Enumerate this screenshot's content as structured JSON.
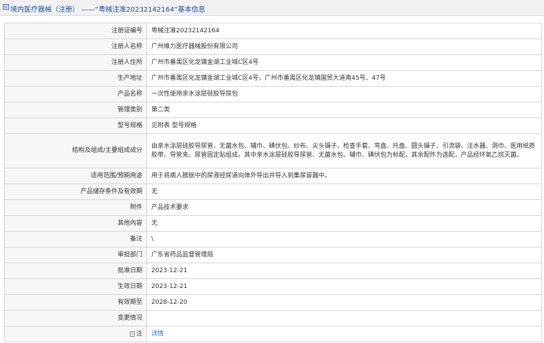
{
  "header": {
    "title": "境内医疗器械（注册） ——“粤械注准20232142164”基本信息"
  },
  "rows": [
    {
      "label": "注册证编号",
      "value": "粤械注准20232142164"
    },
    {
      "label": "注册人名称",
      "value": "广州维力医疗器械股份有限公司"
    },
    {
      "label": "注册人住所",
      "value": "广州市番禺区化龙镇金湖工业城C区4号"
    },
    {
      "label": "生产地址",
      "value": "广州市番禺区化龙镇金湖工业城C区4号，广州市番禺区化龙镇国贸大道南45号、47号"
    },
    {
      "label": "产品名称",
      "value": "一次性使用亲水涂层硅胶导尿包"
    },
    {
      "label": "管理类别",
      "value": "第二类"
    },
    {
      "label": "型号规格",
      "value": "见附表 型号规格"
    },
    {
      "label": "结构及组成/主要组成成分",
      "value": "由亲水涂层硅胶导尿管、无菌水包、辅巾、碘伏包、纱布、尖头镊子、检查手套、弯盘、托盘、圆头镊子、引流袋、注水器、洞巾、医用纸质胶带、导管夹、尿管固定贴组成。其中亲水涂层硅胶导尿管、无菌水包、辅巾、碘伏包为标配，其余配件为选配，产品经环氧乙烷灭菌。"
    },
    {
      "label": "适用范围/预期用途",
      "value": "用于将病人膀胱中的尿液经尿道向体外导出并导入到集尿容器中。"
    },
    {
      "label": "产品储存条件及有效期",
      "value": "无"
    },
    {
      "label": "附件",
      "value": "产品技术要求"
    },
    {
      "label": "其他内容",
      "value": "无"
    },
    {
      "label": "备注",
      "value": "\\"
    },
    {
      "label": "审批部门",
      "value": "广东省药品监督管理局"
    },
    {
      "label": "批准日期",
      "value": "2023-12-21"
    },
    {
      "label": "生效日期",
      "value": "2023-12-21"
    },
    {
      "label": "有效期至",
      "value": "2028-12-20"
    },
    {
      "label": "变更情况",
      "value": ""
    }
  ],
  "note_row": {
    "label": "注",
    "link": "详情",
    "icon": "note-icon"
  }
}
